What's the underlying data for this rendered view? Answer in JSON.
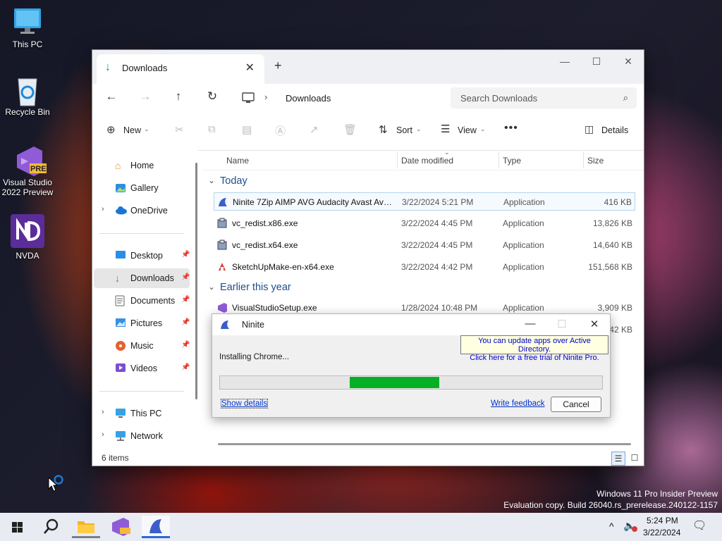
{
  "desktop": {
    "icons": [
      {
        "label": "This PC"
      },
      {
        "label": "Recycle Bin"
      },
      {
        "label": "Visual Studio 2022 Preview",
        "badge": "PRE"
      },
      {
        "label": "NVDA"
      }
    ],
    "watermark_line1": "Windows 11 Pro Insider Preview",
    "watermark_line2": "Evaluation copy. Build 26040.rs_prerelease.240122-1157"
  },
  "explorer": {
    "tab_title": "Downloads",
    "breadcrumb": "Downloads",
    "search_placeholder": "Search Downloads",
    "toolbar": {
      "new_label": "New",
      "sort_label": "Sort",
      "view_label": "View",
      "details_label": "Details"
    },
    "sidebar": {
      "home": "Home",
      "gallery": "Gallery",
      "onedrive": "OneDrive",
      "desktop": "Desktop",
      "downloads": "Downloads",
      "documents": "Documents",
      "pictures": "Pictures",
      "music": "Music",
      "videos": "Videos",
      "thispc": "This PC",
      "network": "Network"
    },
    "columns": {
      "name": "Name",
      "date": "Date modified",
      "type": "Type",
      "size": "Size"
    },
    "groups": {
      "today": "Today",
      "earlier": "Earlier this year"
    },
    "files": [
      {
        "name": "Ninite 7Zip AIMP AVG Audacity Avast Avira Installer.exe",
        "date": "3/22/2024 5:21 PM",
        "type": "Application",
        "size": "416 KB"
      },
      {
        "name": "vc_redist.x86.exe",
        "date": "3/22/2024 4:45 PM",
        "type": "Application",
        "size": "13,826 KB"
      },
      {
        "name": "vc_redist.x64.exe",
        "date": "3/22/2024 4:45 PM",
        "type": "Application",
        "size": "14,640 KB"
      },
      {
        "name": "SketchUpMake-en-x64.exe",
        "date": "3/22/2024 4:42 PM",
        "type": "Application",
        "size": "151,568 KB"
      },
      {
        "name": "VisualStudioSetup.exe",
        "date": "1/28/2024 10:48 PM",
        "type": "Application",
        "size": "3,909 KB"
      },
      {
        "name": "",
        "date": "",
        "type": "",
        "size": "342 KB"
      }
    ],
    "status_count": "6 items"
  },
  "ninite": {
    "title": "Ninite",
    "tooltip_line1": "You can update apps over Active Directory.",
    "tooltip_line2": "Click here for a free trial of Ninite Pro.",
    "status": "Installing Chrome...",
    "progress_start": 0.34,
    "progress_end": 0.575,
    "show_details": "Show details",
    "write_feedback": "Write feedback",
    "cancel": "Cancel"
  },
  "taskbar": {
    "time": "5:24 PM",
    "date": "3/22/2024"
  }
}
